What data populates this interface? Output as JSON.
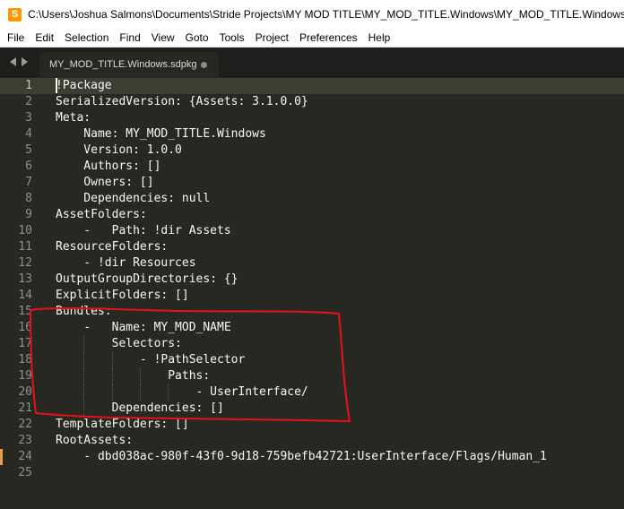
{
  "window": {
    "title": "C:\\Users\\Joshua Salmons\\Documents\\Stride Projects\\MY MOD TITLE\\MY_MOD_TITLE.Windows\\MY_MOD_TITLE.Windows.sdp",
    "app_icon_glyph": "S",
    "app_icon_color": "#ff9800"
  },
  "menu": [
    "File",
    "Edit",
    "Selection",
    "Find",
    "View",
    "Goto",
    "Tools",
    "Project",
    "Preferences",
    "Help"
  ],
  "tab": {
    "label": "MY_MOD_TITLE.Windows.sdpkg",
    "modified_indicator": "dot-icon"
  },
  "editor": {
    "current_line": 1,
    "modified_line": 24,
    "lines": [
      {
        "n": "1",
        "text": "!Package"
      },
      {
        "n": "2",
        "text": "SerializedVersion: {Assets: 3.1.0.0}"
      },
      {
        "n": "3",
        "text": "Meta:"
      },
      {
        "n": "4",
        "text": "    Name: MY_MOD_TITLE.Windows"
      },
      {
        "n": "5",
        "text": "    Version: 1.0.0"
      },
      {
        "n": "6",
        "text": "    Authors: []"
      },
      {
        "n": "7",
        "text": "    Owners: []"
      },
      {
        "n": "8",
        "text": "    Dependencies: null"
      },
      {
        "n": "9",
        "text": "AssetFolders:"
      },
      {
        "n": "10",
        "text": "    -   Path: !dir Assets"
      },
      {
        "n": "11",
        "text": "ResourceFolders:"
      },
      {
        "n": "12",
        "text": "    - !dir Resources"
      },
      {
        "n": "13",
        "text": "OutputGroupDirectories: {}"
      },
      {
        "n": "14",
        "text": "ExplicitFolders: []"
      },
      {
        "n": "15",
        "text": "Bundles:"
      },
      {
        "n": "16",
        "text": "    -   Name: MY_MOD_NAME"
      },
      {
        "n": "17",
        "text": "        Selectors:"
      },
      {
        "n": "18",
        "text": "            - !PathSelector"
      },
      {
        "n": "19",
        "text": "                Paths:"
      },
      {
        "n": "20",
        "text": "                    - UserInterface/"
      },
      {
        "n": "21",
        "text": "        Dependencies: []"
      },
      {
        "n": "22",
        "text": "TemplateFolders: []"
      },
      {
        "n": "23",
        "text": "RootAssets:"
      },
      {
        "n": "24",
        "text": "    - dbd038ac-980f-43f0-9d18-759befb42721:UserInterface/Flags/Human_1"
      },
      {
        "n": "25",
        "text": ""
      }
    ]
  },
  "colors": {
    "editor_bg": "#272822",
    "text": "#f8f8f2",
    "line_number": "#90908a",
    "annotation": "#e8101a",
    "modified_marker": "#e6a04a"
  }
}
